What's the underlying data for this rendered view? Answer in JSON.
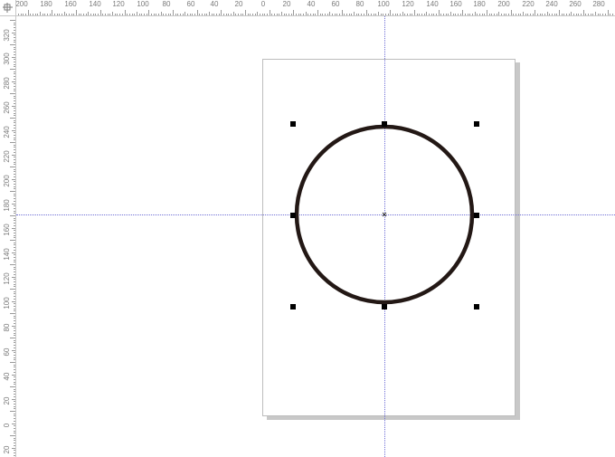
{
  "ruler_top": {
    "labels": [
      "200",
      "180",
      "160",
      "140",
      "120",
      "100",
      "80",
      "60",
      "40",
      "20",
      "0",
      "20",
      "40",
      "60",
      "80",
      "100",
      "120",
      "140",
      "160",
      "180",
      "200",
      "220",
      "240",
      "260",
      "280"
    ]
  },
  "ruler_left": {
    "labels": [
      "320",
      "300",
      "280",
      "260",
      "240",
      "220",
      "200",
      "180",
      "160",
      "140",
      "120",
      "100",
      "80",
      "60",
      "40",
      "20",
      "0",
      "20"
    ]
  },
  "colors": {
    "guide": "#6e6ed6",
    "shape_stroke": "#231815",
    "page_border": "#bdbdbd",
    "ruler_text": "#7a7a7a"
  },
  "icons": {
    "ruler_origin": "origin-crosshair-icon",
    "center_marker": "center-x-icon"
  }
}
